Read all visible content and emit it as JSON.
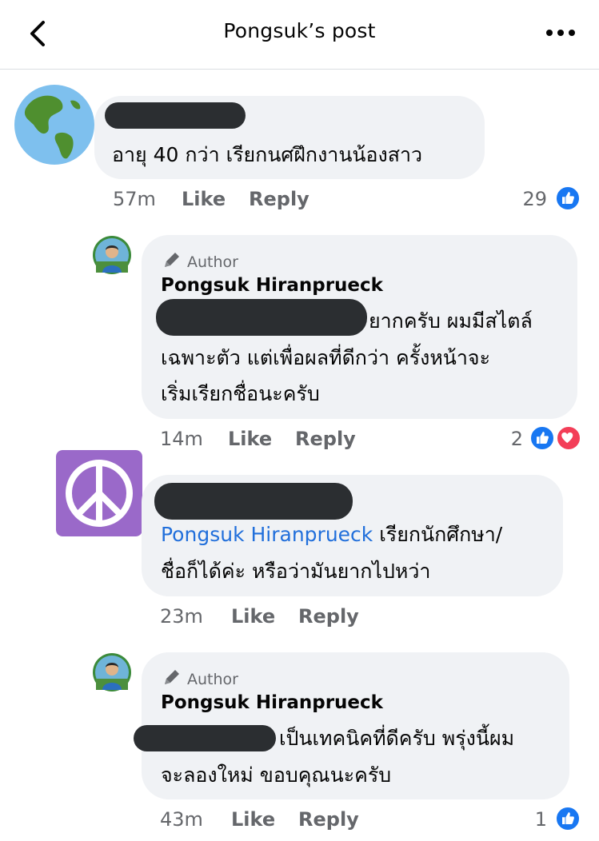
{
  "header": {
    "title": "Pongsuk’s post",
    "back_icon": "chevron-left-icon",
    "more_icon": "ellipsis-icon"
  },
  "actions": {
    "like": "Like",
    "reply": "Reply"
  },
  "comments": [
    {
      "text_line1": "อายุ 40 กว่า เรียกนศฝึกงานน้องสาว",
      "time": "57m",
      "reaction_count": "29",
      "reactions": [
        "like-icon"
      ]
    },
    {
      "badge": "Author",
      "name": "Pongsuk Hiranprueck",
      "text_line1": "ยากครับ ผมมีสไตล์",
      "text_line2": "เฉพาะตัว แต่เพื่อผลที่ดีกว่า ครั้งหน้าจะ",
      "text_line3": "เริ่มเรียกชื่อนะครับ",
      "time": "14m",
      "reaction_count": "2",
      "reactions": [
        "like-icon",
        "love-icon"
      ]
    },
    {
      "mention": "Pongsuk Hiranprueck",
      "text_line1": " เรียกนักศึกษา/",
      "text_line2": "ชื่อก็ได้ค่ะ หรือว่ามันยากไปหว่า",
      "time": "23m",
      "reaction_count": ""
    },
    {
      "badge": "Author",
      "name": "Pongsuk Hiranprueck",
      "text_line1": "เป็นเทคนิคที่ดีครับ พรุ่งนี้ผม",
      "text_line2": "จะลองใหม่ ขอบคุณนะครับ",
      "time": "43m",
      "reaction_count": "1",
      "reactions": [
        "like-icon"
      ]
    }
  ],
  "colors": {
    "bubble": "#f0f2f5",
    "meta": "#65676b",
    "mention": "#216fdb",
    "like": "#1877f2",
    "love": "#f33e58",
    "peace_bg": "#9a69c9"
  }
}
